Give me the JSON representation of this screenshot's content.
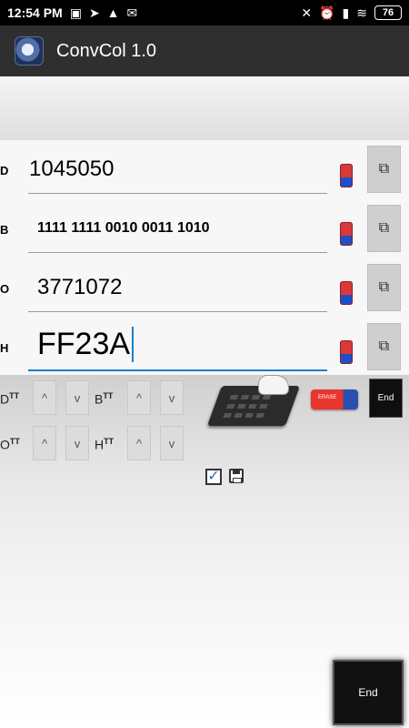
{
  "status_bar": {
    "time": "12:54 PM",
    "battery_level": "76",
    "left_icons": [
      "photo-icon",
      "navigation-icon",
      "warning-icon",
      "message-icon"
    ],
    "right_icons": [
      "vibration-mute-icon",
      "alarm-icon",
      "signal-icon",
      "wifi-icon",
      "battery-icon"
    ]
  },
  "app_bar": {
    "title": "ConvCol 1.0",
    "icon": "app-logo-icon"
  },
  "rows": [
    {
      "label": "D",
      "value": "1045050"
    },
    {
      "label": "B",
      "value": "1111 1111 0010 0011 1010"
    },
    {
      "label": "O",
      "value": "3771072"
    },
    {
      "label": "H",
      "value": "FF23A"
    }
  ],
  "controls": {
    "d_label": "D",
    "b_label": "B",
    "o_label": "O",
    "h_label": "H",
    "size_marker": "TT",
    "spin_up": "^",
    "spin_down": "v",
    "eraser_text": "ERASE",
    "end_small_label": "End",
    "end_big_label": "End"
  },
  "colors": {
    "app_bar": "#2f2f2f",
    "status_bar": "#000000",
    "accent_line": "#1c7ec8",
    "eraser_red": "#d83a3a",
    "eraser_blue": "#1e4fc8"
  }
}
